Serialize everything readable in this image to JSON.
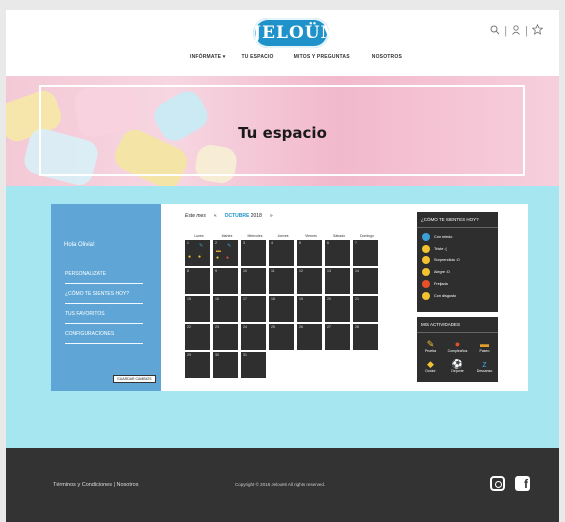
{
  "header": {
    "logo_text": "JELOÜMi",
    "nav": [
      "INFÓRMATE ▾",
      "TU ESPACIO",
      "MITOS Y PREGUNTAS",
      "NOSOTROS"
    ],
    "icons": [
      "search-icon",
      "user-icon",
      "star-icon"
    ]
  },
  "hero": {
    "title": "Tu espacio"
  },
  "sidebar": {
    "greeting": "Hola Olivia!",
    "items": [
      "PERSONALIZATE",
      "¿CÓMO TE SIENTES HOY?",
      "TUS FAVORITOS",
      "CONFIGURACIONES"
    ],
    "save_label": "GUARDAR CAMBIOS"
  },
  "calendar": {
    "this_month_label": "Este mes",
    "prev": "«",
    "next": "»",
    "month": "OCTUBRE",
    "year": "2018",
    "weekdays": [
      "Lunes",
      "Martes",
      "Miércoles",
      "Jueves",
      "Viernes",
      "Sábado",
      "Domingo"
    ],
    "days": [
      "1",
      "2",
      "3",
      "4",
      "5",
      "6",
      "7",
      "8",
      "9",
      "10",
      "11",
      "12",
      "13",
      "14",
      "15",
      "16",
      "17",
      "18",
      "19",
      "20",
      "21",
      "22",
      "23",
      "24",
      "25",
      "26",
      "27",
      "28",
      "29",
      "30",
      "31"
    ]
  },
  "feelings": {
    "title": "¿CÓMO TE SIENTES HOY?",
    "items": [
      {
        "label": "Con miedo",
        "icon": "scared-face-icon",
        "color": "#3aa0d8"
      },
      {
        "label": "Triste :(",
        "icon": "sad-face-icon",
        "color": "#f2c230"
      },
      {
        "label": "Sorprendida :O",
        "icon": "surprised-face-icon",
        "color": "#f2c230"
      },
      {
        "label": "Alegre :D",
        "icon": "happy-face-icon",
        "color": "#f2c230"
      },
      {
        "label": "Freijada",
        "icon": "angry-face-icon",
        "color": "#e8502a"
      },
      {
        "label": "Con disgusto",
        "icon": "disgusted-face-icon",
        "color": "#f2c230"
      }
    ]
  },
  "activities": {
    "title": "MIS ACTIVIDADES",
    "items": [
      {
        "label": "Prueba",
        "icon": "test-icon"
      },
      {
        "label": "Cumpleaños",
        "icon": "balloon-icon"
      },
      {
        "label": "Paseo",
        "icon": "bus-icon"
      },
      {
        "label": "Doctor",
        "icon": "pill-icon"
      },
      {
        "label": "Deporte",
        "icon": "ball-icon"
      },
      {
        "label": "Descanso",
        "icon": "sleep-icon"
      }
    ]
  },
  "footer": {
    "links": "Términos y Condiciones  |  Nosotros",
    "copyright": "Copyright © 2018 JelouMi All rights reserved.",
    "social": [
      "instagram-icon",
      "facebook-icon"
    ]
  },
  "colors": {
    "brand": "#1f93c9",
    "sidebar": "#5fa6d6",
    "section_bg": "#a6e6f0",
    "dark": "#2e2e2e"
  }
}
